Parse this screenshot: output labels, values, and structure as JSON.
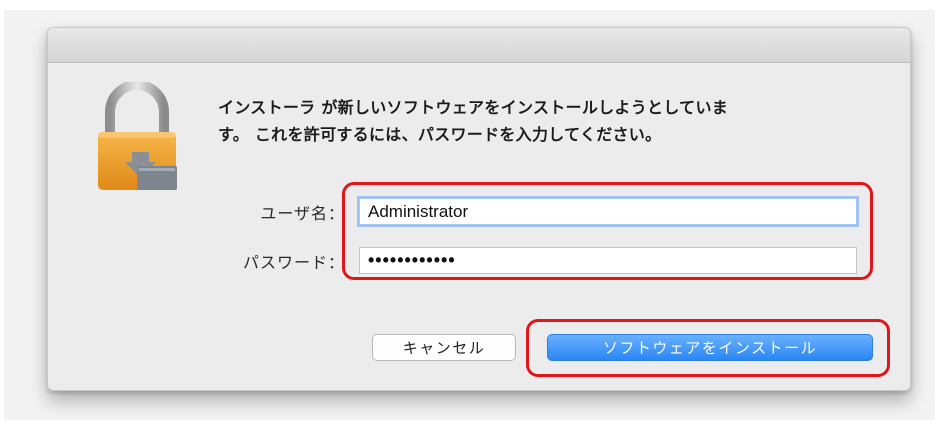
{
  "dialog": {
    "message_line1": "インストーラ が新しいソフトウェアをインストールしようとしていま",
    "message_line2": "す。 これを許可するには、パスワードを入力してください。",
    "username_label": "ユーザ名：",
    "username_value": "Administrator",
    "password_label": "パスワード：",
    "password_value": "••••••••••••",
    "cancel_label": "キャンセル",
    "install_label": "ソフトウェアをインストール"
  },
  "icons": {
    "lock": "lock-icon"
  },
  "colors": {
    "primary_button": "#2a86f4",
    "highlight": "#e5141a",
    "focus_ring": "#9ec2f5"
  }
}
